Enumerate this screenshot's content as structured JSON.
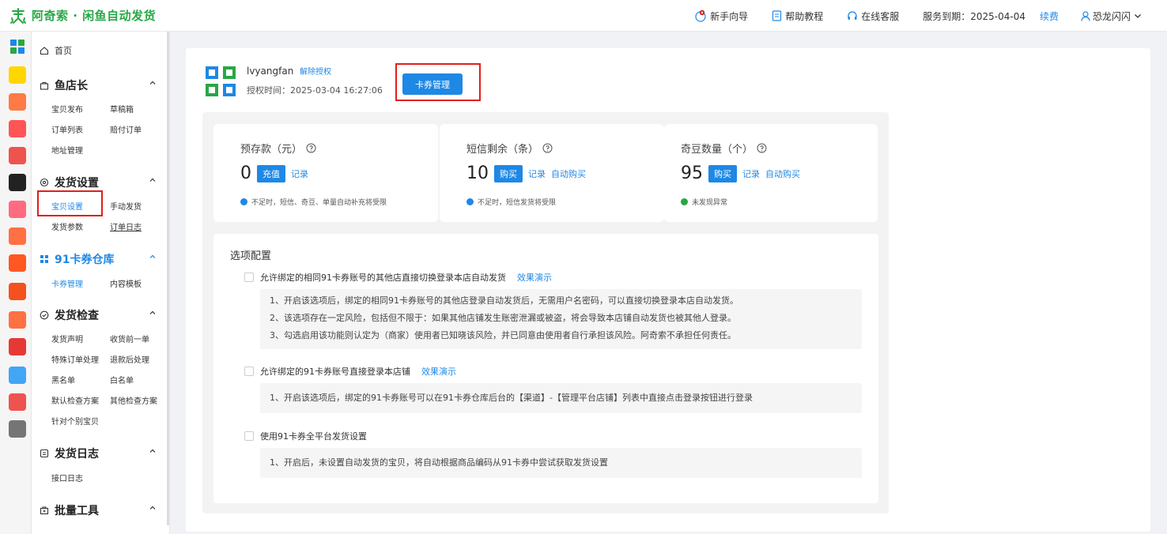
{
  "header": {
    "brand": "阿奇索 · 闲鱼自动发货",
    "guide": "新手向导",
    "help": "帮助教程",
    "service": "在线客服",
    "expiry": "服务到期：2025-04-04",
    "renew": "续费",
    "user": "恐龙闪闪"
  },
  "sidebar": {
    "home": "首页",
    "sections": [
      {
        "title": "鱼店长",
        "items": [
          "宝贝发布",
          "草稿箱",
          "订单列表",
          "赔付订单",
          "地址管理"
        ]
      },
      {
        "title": "发货设置",
        "items": [
          "宝贝设置",
          "手动发货",
          "发货参数",
          "订单日志"
        ]
      },
      {
        "title": "91卡券仓库",
        "items": [
          "卡券管理",
          "内容模板"
        ]
      },
      {
        "title": "发货检查",
        "items": [
          "发货声明",
          "收货前一单",
          "特殊订单处理",
          "退款后处理",
          "黑名单",
          "白名单",
          "默认检查方案",
          "其他检查方案",
          "针对个别宝贝"
        ]
      },
      {
        "title": "发货日志",
        "items": [
          "接口日志"
        ]
      },
      {
        "title": "批量工具",
        "items": []
      }
    ]
  },
  "account": {
    "name": "lvyangfan",
    "unbind": "解除授权",
    "auth_time": "授权时间：2025-03-04 16:27:06",
    "manage_button": "卡券管理"
  },
  "stats": [
    {
      "label": "预存款（元）",
      "value": "0",
      "button": "充值",
      "links": [
        "记录"
      ],
      "note": "不足时，短信、奇豆、单量自动补充将受限",
      "note_color": "#1e88e5"
    },
    {
      "label": "短信剩余（条）",
      "value": "10",
      "button": "购买",
      "links": [
        "记录",
        "自动购买"
      ],
      "note": "不足时，短信发货将受限",
      "note_color": "#1e88e5"
    },
    {
      "label": "奇豆数量（个）",
      "value": "95",
      "button": "购买",
      "links": [
        "记录",
        "自动购买"
      ],
      "note": "未发现异常",
      "note_color": "#28a745"
    }
  ],
  "options": {
    "title": "选项配置",
    "items": [
      {
        "label": "允许绑定的相同91卡券账号的其他店直接切换登录本店自动发货",
        "link": "效果演示",
        "desc": [
          "1、开启该选项后，绑定的相同91卡券账号的其他店登录自动发货后，无需用户名密码，可以直接切换登录本店自动发货。",
          "2、该选项存在一定风险，包括但不限于：如果其他店铺发生账密泄漏或被盗，将会导致本店铺自动发货也被其他人登录。",
          "3、勾选启用该功能则认定为（商家）使用者已知晓该风险，并已同意由使用者自行承担该风险。阿奇索不承担任何责任。"
        ]
      },
      {
        "label": "允许绑定的91卡券账号直接登录本店铺",
        "link": "效果演示",
        "desc": [
          "1、开启该选项后，绑定的91卡券账号可以在91卡券仓库后台的【渠道】-【管理平台店铺】列表中直接点击登录按钮进行登录"
        ]
      },
      {
        "label": "使用91卡券全平台发货设置",
        "link": "",
        "desc": [
          "1、开启后，未设置自动发货的宝贝，将自动根据商品编码从91卡券中尝试获取发货设置"
        ]
      }
    ]
  },
  "colors": {
    "accent": "#1e88e5",
    "brand": "#28a745",
    "highlight": "#e0201b"
  }
}
